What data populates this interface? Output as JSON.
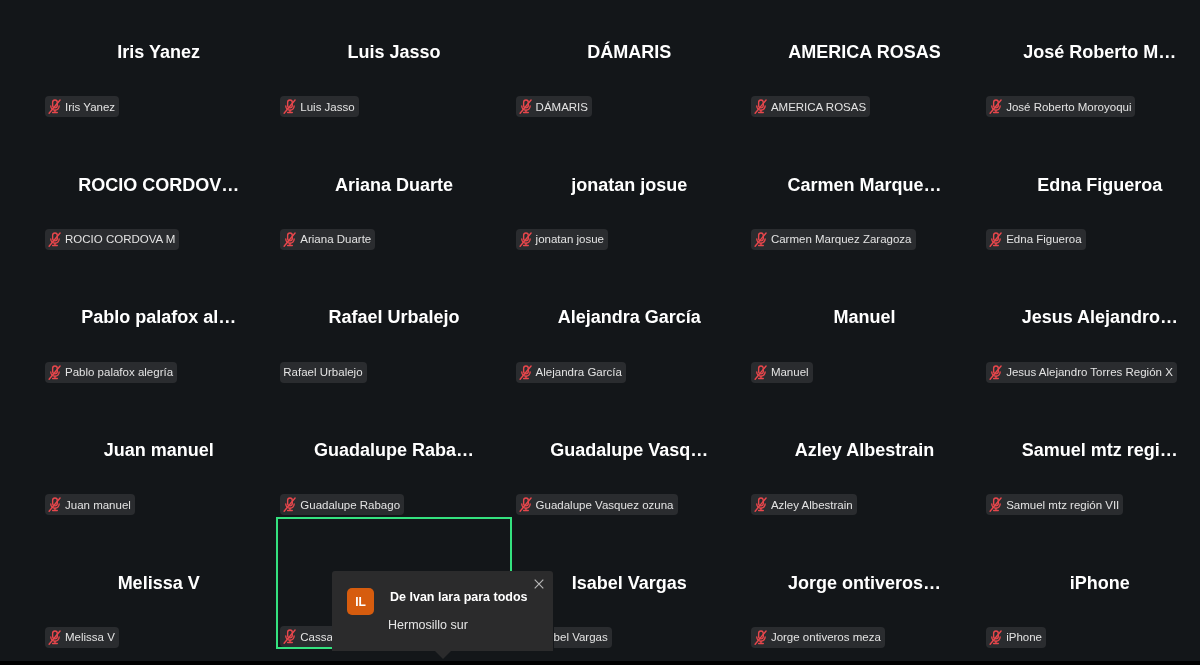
{
  "gallery": {
    "tiles": [
      {
        "display_name": "Iris Yanez",
        "active_speaker": false,
        "name_tag": {
          "kind": "whole",
          "label": "Iris Yanez",
          "muted": true
        }
      },
      {
        "display_name": "Luis Jasso",
        "active_speaker": false,
        "name_tag": {
          "kind": "whole",
          "label": "Luis Jasso",
          "muted": true
        }
      },
      {
        "display_name": "DÁMARIS",
        "active_speaker": false,
        "name_tag": {
          "kind": "whole",
          "label": "DÁMARIS",
          "muted": true
        }
      },
      {
        "display_name": "AMERICA ROSAS",
        "active_speaker": false,
        "name_tag": {
          "kind": "whole",
          "label": "AMERICA ROSAS",
          "muted": true
        }
      },
      {
        "display_name": "José Roberto M…",
        "active_speaker": false,
        "name_tag": {
          "kind": "whole",
          "label": "José Roberto Moroyoqui",
          "muted": true
        }
      },
      {
        "display_name": "ROCIO CORDOV…",
        "active_speaker": false,
        "name_tag": {
          "kind": "whole",
          "label": "ROCIO CORDOVA M",
          "muted": true
        }
      },
      {
        "display_name": "Ariana Duarte",
        "active_speaker": false,
        "name_tag": {
          "kind": "whole",
          "label": "Ariana Duarte",
          "muted": true
        }
      },
      {
        "display_name": "jonatan josue",
        "active_speaker": false,
        "name_tag": {
          "kind": "whole",
          "label": "jonatan josue",
          "muted": true
        }
      },
      {
        "display_name": "Carmen Marque…",
        "active_speaker": false,
        "name_tag": {
          "kind": "whole",
          "label": "Carmen Marquez Zaragoza",
          "muted": true
        }
      },
      {
        "display_name": "Edna Figueroa",
        "active_speaker": false,
        "name_tag": {
          "kind": "whole",
          "label": "Edna Figueroa",
          "muted": true
        }
      },
      {
        "display_name": "Pablo palafox al…",
        "active_speaker": false,
        "name_tag": {
          "kind": "whole",
          "label": "Pablo palafox alegría",
          "muted": true
        }
      },
      {
        "display_name": "Rafael Urbalejo",
        "active_speaker": false,
        "name_tag": {
          "kind": "whole",
          "label": "Rafael Urbalejo",
          "muted": false
        }
      },
      {
        "display_name": "Alejandra García",
        "active_speaker": false,
        "name_tag": {
          "kind": "whole",
          "label": "Alejandra García",
          "muted": true
        }
      },
      {
        "display_name": "Manuel",
        "active_speaker": false,
        "name_tag": {
          "kind": "whole",
          "label": "Manuel",
          "muted": true
        }
      },
      {
        "display_name": "Jesus Alejandro…",
        "active_speaker": false,
        "name_tag": {
          "kind": "whole",
          "label": "Jesus Alejandro Torres Región X",
          "muted": true
        }
      },
      {
        "display_name": "Juan manuel",
        "active_speaker": false,
        "name_tag": {
          "kind": "whole",
          "label": "Juan manuel",
          "muted": true
        }
      },
      {
        "display_name": "Guadalupe Raba…",
        "active_speaker": false,
        "name_tag": {
          "kind": "whole",
          "label": "Guadalupe Rabago",
          "muted": true
        }
      },
      {
        "display_name": "Guadalupe Vasq…",
        "active_speaker": false,
        "name_tag": {
          "kind": "whole",
          "label": "Guadalupe Vasquez ozuna",
          "muted": true
        }
      },
      {
        "display_name": "Azley Albestrain",
        "active_speaker": false,
        "name_tag": {
          "kind": "whole",
          "label": "Azley Albestrain",
          "muted": true
        }
      },
      {
        "display_name": "Samuel mtz regi…",
        "active_speaker": false,
        "name_tag": {
          "kind": "whole",
          "label": "Samuel mtz región VII",
          "muted": true
        }
      },
      {
        "display_name": "Melissa V",
        "active_speaker": false,
        "name_tag": {
          "kind": "whole",
          "label": "Melissa V",
          "muted": true
        }
      },
      {
        "active_speaker": true,
        "name_tag": {
          "kind": "cut_end",
          "label": "Cassa",
          "muted": true
        }
      },
      {
        "display_name": "Isabel Vargas",
        "active_speaker": false,
        "name_tag": {
          "kind": "cut_start",
          "label": "bel Vargas"
        }
      },
      {
        "display_name": "Jorge ontiveros…",
        "active_speaker": false,
        "name_tag": {
          "kind": "whole",
          "label": "Jorge ontiveros meza",
          "muted": true
        }
      },
      {
        "display_name": "iPhone",
        "active_speaker": false,
        "name_tag": {
          "kind": "whole",
          "label": "iPhone",
          "muted": true
        }
      }
    ]
  },
  "chat_notification": {
    "avatar_initials": "IL",
    "title": "De Ivan lara para todos",
    "message": "Hermosillo sur"
  }
}
